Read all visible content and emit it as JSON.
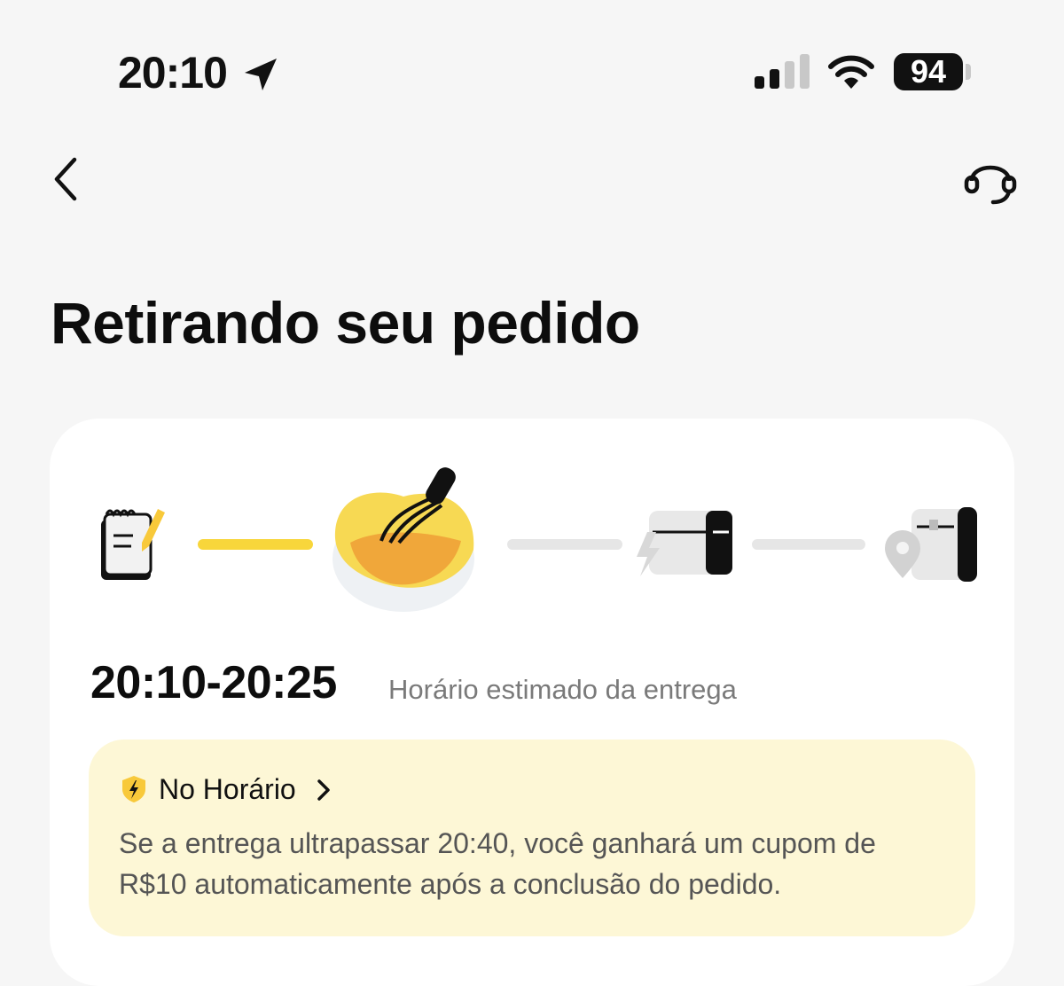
{
  "status_bar": {
    "time": "20:10",
    "battery": "94",
    "icons": [
      "location-arrow-icon",
      "signal-icon",
      "wifi-icon",
      "battery-icon"
    ]
  },
  "nav": {
    "back_icon": "chevron-left-icon",
    "support_icon": "headset-icon"
  },
  "page": {
    "title": "Retirando seu pedido"
  },
  "progress": {
    "steps": [
      {
        "icon": "notepad-icon",
        "state": "done"
      },
      {
        "icon": "whisk-bowl-icon",
        "state": "current"
      },
      {
        "icon": "delivery-bag-icon",
        "state": "pending"
      },
      {
        "icon": "location-bag-icon",
        "state": "pending"
      }
    ],
    "colors": {
      "done": "#f8d63b",
      "pending": "#e6e6e6"
    }
  },
  "eta": {
    "time": "20:10-20:25",
    "label": "Horário estimado da entrega"
  },
  "guarantee": {
    "icon": "lightning-shield-icon",
    "title": "No Horário",
    "text_line1": "Se a entrega ultrapassar 20:40, você ganhará um cupom de",
    "text_line2": "R$10 automaticamente após a conclusão do pedido.",
    "background": "#fdf7d6"
  }
}
